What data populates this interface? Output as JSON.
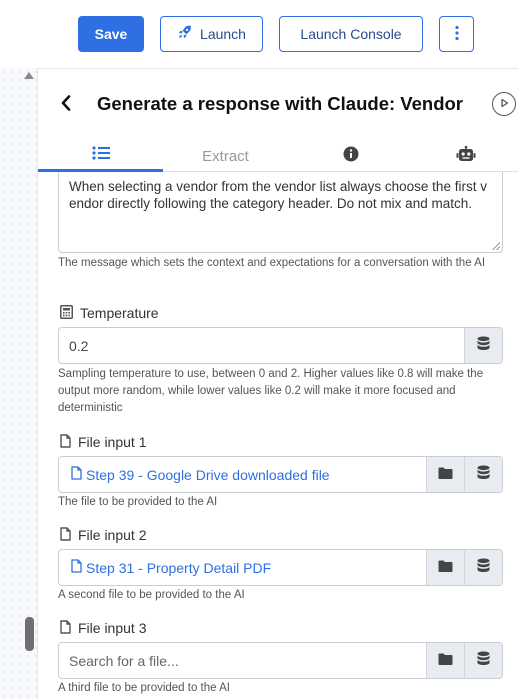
{
  "toolbar": {
    "save_label": "Save",
    "launch_label": "Launch",
    "console_label": "Launch Console",
    "more_icon": "more-vertical-icon"
  },
  "panel": {
    "title": "Generate a response with Claude: Vendor"
  },
  "tabs": [
    {
      "label": "",
      "icon": "list-icon",
      "active": true
    },
    {
      "label": "Extract",
      "icon": "",
      "active": false
    },
    {
      "label": "",
      "icon": "info-icon",
      "active": false
    },
    {
      "label": "",
      "icon": "robot-icon",
      "active": false
    }
  ],
  "system_message": {
    "value": "When selecting a vendor from the vendor list always choose the first vendor directly following the category header. Do not mix and match.",
    "help": "The message which sets the context and expectations for a conversation with the AI"
  },
  "temperature": {
    "label": "Temperature",
    "value": "0.2",
    "help": "Sampling temperature to use, between 0 and 2. Higher values like 0.8 will make the output more random, while lower values like 0.2 will make it more focused and deterministic"
  },
  "file_inputs": [
    {
      "label": "File input 1",
      "value": "Step 39 - Google Drive downloaded file",
      "placeholder": "",
      "help": "The file to be provided to the AI"
    },
    {
      "label": "File input 2",
      "value": "Step 31 - Property Detail PDF",
      "placeholder": "",
      "help": "A second file to be provided to the AI"
    },
    {
      "label": "File input 3",
      "value": "",
      "placeholder": "Search for a file...",
      "help": "A third file to be provided to the AI"
    }
  ],
  "colors": {
    "accent": "#2f6fe4",
    "addon_bg": "#e8ebef"
  }
}
